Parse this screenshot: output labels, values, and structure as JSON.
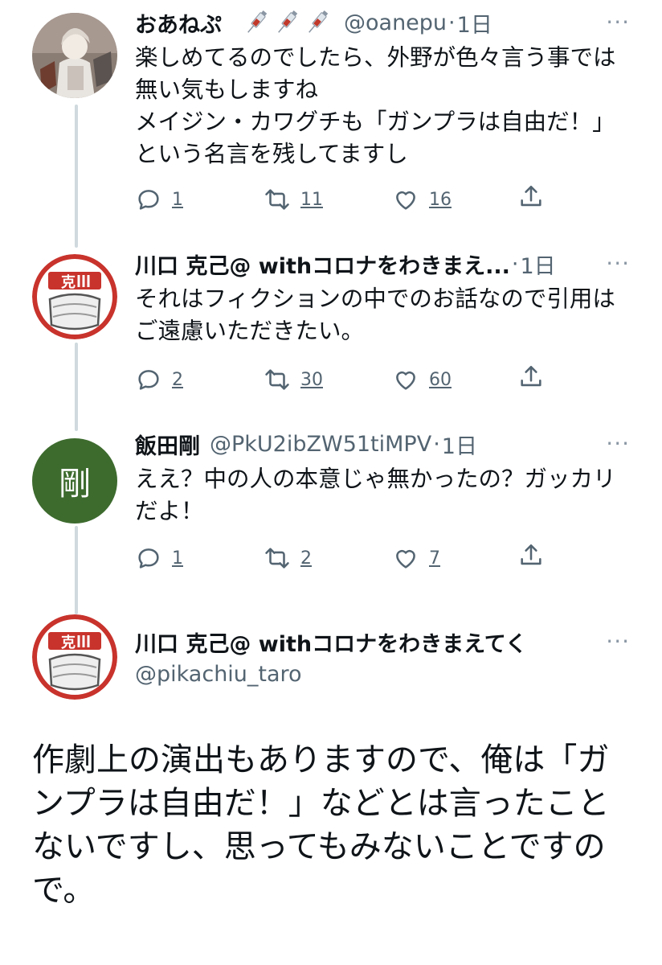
{
  "tweets": [
    {
      "name": "おあねぷ",
      "handle": "@oanepu",
      "dot": "·",
      "time": "1日",
      "text": "楽しめてるのでしたら、外野が色々言う事では無い気もしますね\nメイジン・カワグチも「ガンプラは自由だ！」という名言を残してますし",
      "replies": "1",
      "retweets": "11",
      "likes": "16",
      "more": "···"
    },
    {
      "name": "川口 克己@ withコロナをわきまえ...",
      "handle": "",
      "dot": "·",
      "time": "1日",
      "text": "それはフィクションの中でのお話なので引用はご遠慮いただきたい。",
      "replies": "2",
      "retweets": "30",
      "likes": "60",
      "more": "···"
    },
    {
      "name": "飯田剛",
      "handle": "@PkU2ibZW51tiMPV",
      "dot": "·",
      "time": "1日",
      "text": "ええ？中の人の本意じゃ無かったの？ガッカリだよ！",
      "replies": "1",
      "retweets": "2",
      "likes": "7",
      "more": "···",
      "avatar_char": "剛"
    }
  ],
  "main": {
    "name": "川口 克己@ withコロナをわきまえてく",
    "handle": "@pikachiu_taro",
    "more": "···",
    "text": "作劇上の演出もありますので、俺は「ガンプラは自由だ！」などとは言ったことないですし、思ってもみないことですので。"
  },
  "colors": {
    "text": "#0f1419",
    "muted": "#536471",
    "thread_line": "#cfd9de",
    "avatar_green": "#3d6b2e",
    "badge_red": "#c8332c"
  },
  "icons": [
    "reply-icon",
    "retweet-icon",
    "like-icon",
    "share-icon",
    "syringe-icon"
  ]
}
